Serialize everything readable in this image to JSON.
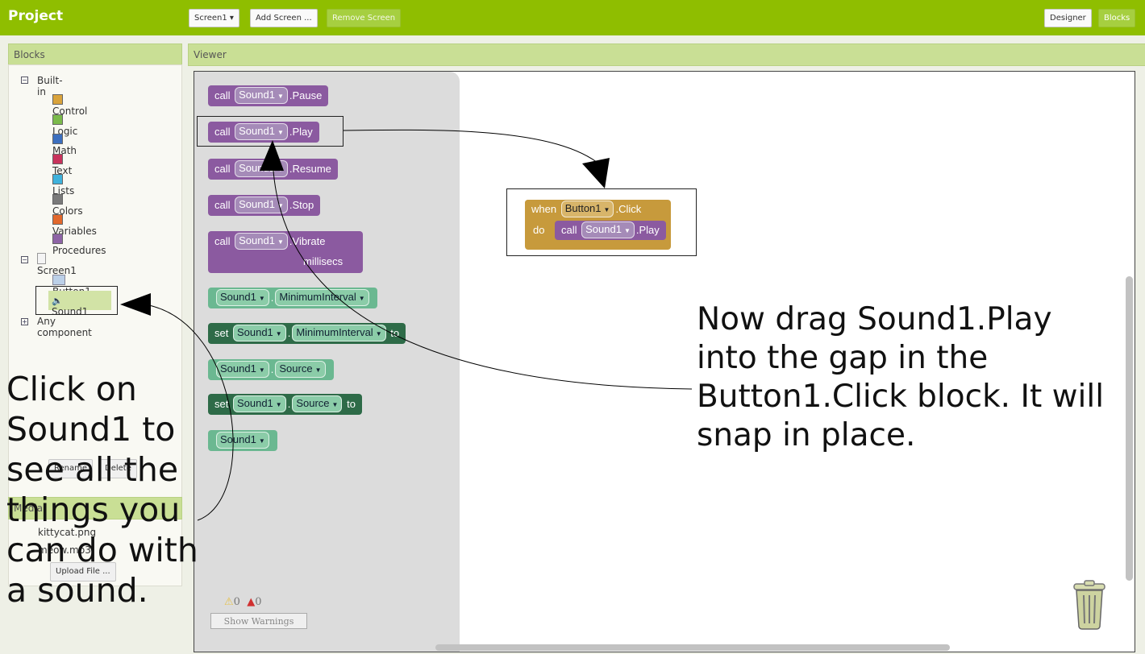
{
  "topbar": {
    "title": "Project",
    "screen_select": "Screen1 ▾",
    "add_screen": "Add Screen ...",
    "remove_screen": "Remove Screen",
    "designer": "Designer",
    "blocks": "Blocks"
  },
  "blocks_panel": {
    "header": "Blocks",
    "builtin_label": "Built-in",
    "builtin": [
      {
        "label": "Control",
        "color": "#d9a33b"
      },
      {
        "label": "Logic",
        "color": "#7bba4b"
      },
      {
        "label": "Math",
        "color": "#3c6fbf"
      },
      {
        "label": "Text",
        "color": "#c8335c"
      },
      {
        "label": "Lists",
        "color": "#3fb2dc"
      },
      {
        "label": "Colors",
        "color": "#7a7a7a"
      },
      {
        "label": "Variables",
        "color": "#e2682c"
      },
      {
        "label": "Procedures",
        "color": "#8e64a6"
      }
    ],
    "screen_label": "Screen1",
    "button_label": "Button1",
    "sound_label": "Sound1",
    "any_component": "Any component",
    "rename": "Rename",
    "delete": "Delete",
    "media_header": "Media",
    "media_file_1": "kittycat.png",
    "media_file_2": "meow.mp3",
    "upload": "Upload File ..."
  },
  "viewer": {
    "header": "Viewer",
    "warnings_count": "0",
    "errors_count": "0",
    "show_warnings": "Show Warnings"
  },
  "drawer_blocks": {
    "call": "call",
    "sound1": "Sound1",
    "pause": ".Pause",
    "play": ".Play",
    "resume": ".Resume",
    "stop": ".Stop",
    "vibrate": ".Vibrate",
    "millisecs": "millisecs",
    "dot": ".",
    "minimum_interval": "MinimumInterval",
    "set": "set",
    "to": "to",
    "source": "Source"
  },
  "workspace_block": {
    "when": "when",
    "button1": "Button1",
    "click": ".Click",
    "do": "do",
    "call": "call",
    "sound1": "Sound1",
    "play": ".Play"
  },
  "annotations": {
    "right": "Now drag Sound1.Play into the gap in the Button1.Click block. It will snap in place.",
    "left": "Click on Sound1 to see all the things you can do with a sound."
  }
}
